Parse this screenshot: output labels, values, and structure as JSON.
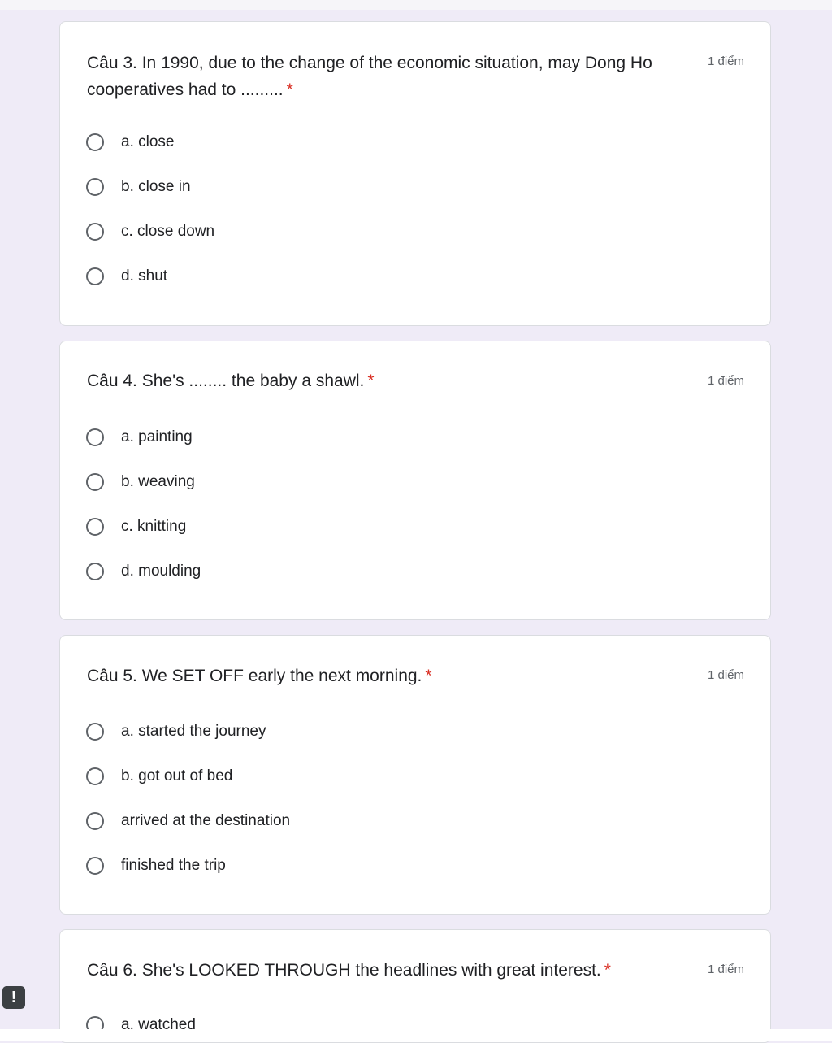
{
  "questions": [
    {
      "text": "Câu 3. In 1990, due to the change of the economic situation, may Dong Ho cooperatives had to .........",
      "required": "*",
      "points": "1 điểm",
      "options": [
        "a. close",
        "b. close in",
        "c. close down",
        "d. shut"
      ]
    },
    {
      "text": "Câu 4. She's ........ the baby a shawl.",
      "required": "*",
      "points": "1 điểm",
      "options": [
        "a. painting",
        "b. weaving",
        "c. knitting",
        "d. moulding"
      ]
    },
    {
      "text": "Câu 5. We SET OFF early the next morning.",
      "required": "*",
      "points": "1 điểm",
      "options": [
        "a. started the journey",
        "b. got out of bed",
        "arrived at the destination",
        "finished the trip"
      ]
    },
    {
      "text": "Câu 6. She's LOOKED THROUGH the headlines with great interest.",
      "required": "*",
      "points": "1 điểm",
      "options": [
        "a. watched"
      ]
    }
  ],
  "feedback_icon": "exclamation-icon",
  "feedback_symbol": "!"
}
